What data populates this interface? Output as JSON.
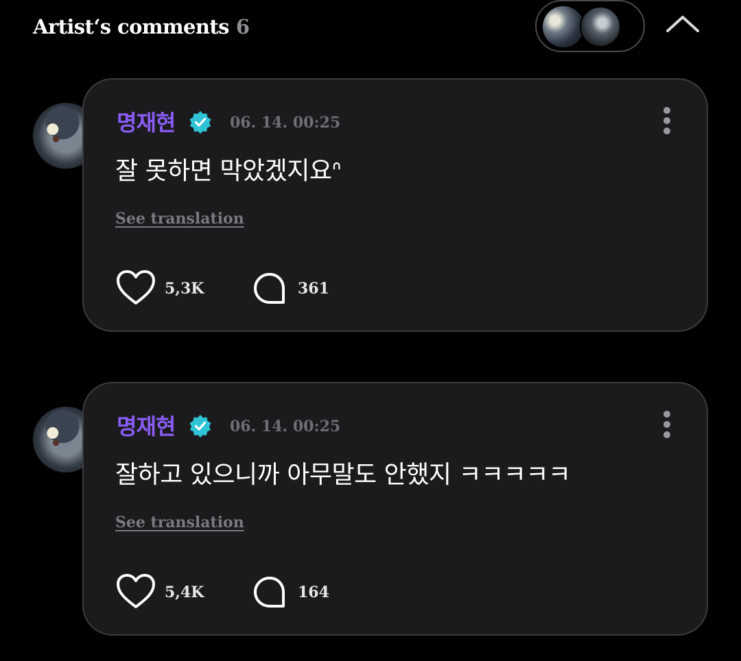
{
  "header": {
    "title": "Artist‘s comments",
    "count": "6",
    "collapse_icon": "chevron-up-icon"
  },
  "colors": {
    "background": "#000000",
    "card": "#1b1b1d",
    "card_border": "#3c3c3f",
    "author": "#8b5cf6",
    "verified": "#2ec4d6",
    "muted": "#6e6e73"
  },
  "comments": [
    {
      "author": "명재현",
      "verified_icon": "verified-badge-icon",
      "timestamp": "06. 14. 00:25",
      "text": "잘 못하면 막았겠지요ᐢ",
      "translation_link": "See translation",
      "likes": "5,3K",
      "replies": "361"
    },
    {
      "author": "명재현",
      "verified_icon": "verified-badge-icon",
      "timestamp": "06. 14. 00:25",
      "text": "잘하고 있으니까 아무말도 안했지 ㅋㅋㅋㅋㅋ",
      "translation_link": "See translation",
      "likes": "5,4K",
      "replies": "164"
    }
  ]
}
